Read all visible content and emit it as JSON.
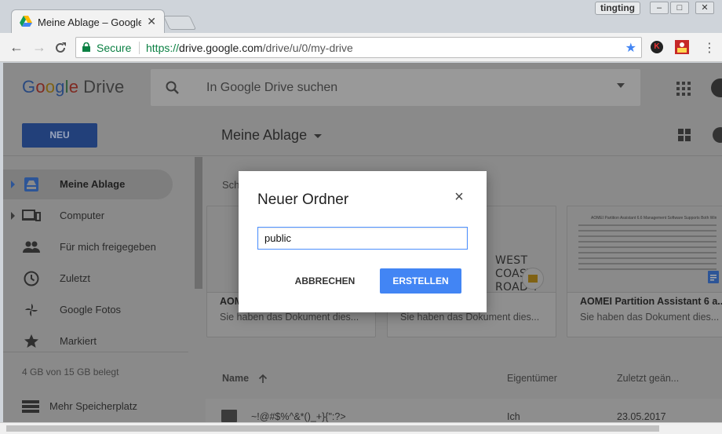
{
  "browser": {
    "tab_title": "Meine Ablage – Google Drive",
    "user_name": "tingting",
    "secure_label": "Secure",
    "url_scheme": "https://",
    "url_host": "drive.google.com",
    "url_path": "/drive/u/0/my-drive",
    "ext_k": "K"
  },
  "header": {
    "logo_g": "G",
    "logo_o1": "o",
    "logo_o2": "o",
    "logo_g2": "g",
    "logo_l": "l",
    "logo_e": "e",
    "logo_drive": "Drive",
    "search_placeholder": "In Google Drive suchen"
  },
  "toolbar": {
    "new_label": "NEU",
    "location_title": "Meine Ablage"
  },
  "sidebar": {
    "items": [
      {
        "label": "Meine Ablage"
      },
      {
        "label": "Computer"
      },
      {
        "label": "Für mich freigegeben"
      },
      {
        "label": "Zuletzt"
      },
      {
        "label": "Google Fotos"
      },
      {
        "label": "Markiert"
      }
    ],
    "storage_text": "4 GB von 15 GB belegt",
    "more_storage": "Mehr Speicherplatz"
  },
  "main": {
    "section_label": "Sch",
    "cards": [
      {
        "name": "AOM",
        "subtitle": "Sie haben das Dokument dies..."
      },
      {
        "name": "",
        "subtitle": "Sie haben das Dokument dies...",
        "thumb_text_1": "WEST COAST",
        "thumb_text_2": "ROAD T"
      },
      {
        "name": "AOMEI Partition Assistant 6 a...",
        "subtitle": "Sie haben das Dokument dies...",
        "thumb_heading": "AOMEI Partition Assistant 6.6 Management Software Supports Both Windows Desktop"
      }
    ],
    "list_headers": {
      "name": "Name",
      "owner": "Eigentümer",
      "modified": "Zuletzt geän..."
    },
    "rows": [
      {
        "name": "~!@#$%^&*()_+}{\":?>",
        "owner": "Ich",
        "modified": "23.05.2017"
      }
    ]
  },
  "dialog": {
    "title": "Neuer Ordner",
    "input_value": "public",
    "cancel_label": "ABBRECHEN",
    "create_label": "ERSTELLEN"
  },
  "colors": {
    "primary_blue": "#4285f4",
    "secure_green": "#0b8043",
    "focus_blue": "#4d90fe"
  }
}
